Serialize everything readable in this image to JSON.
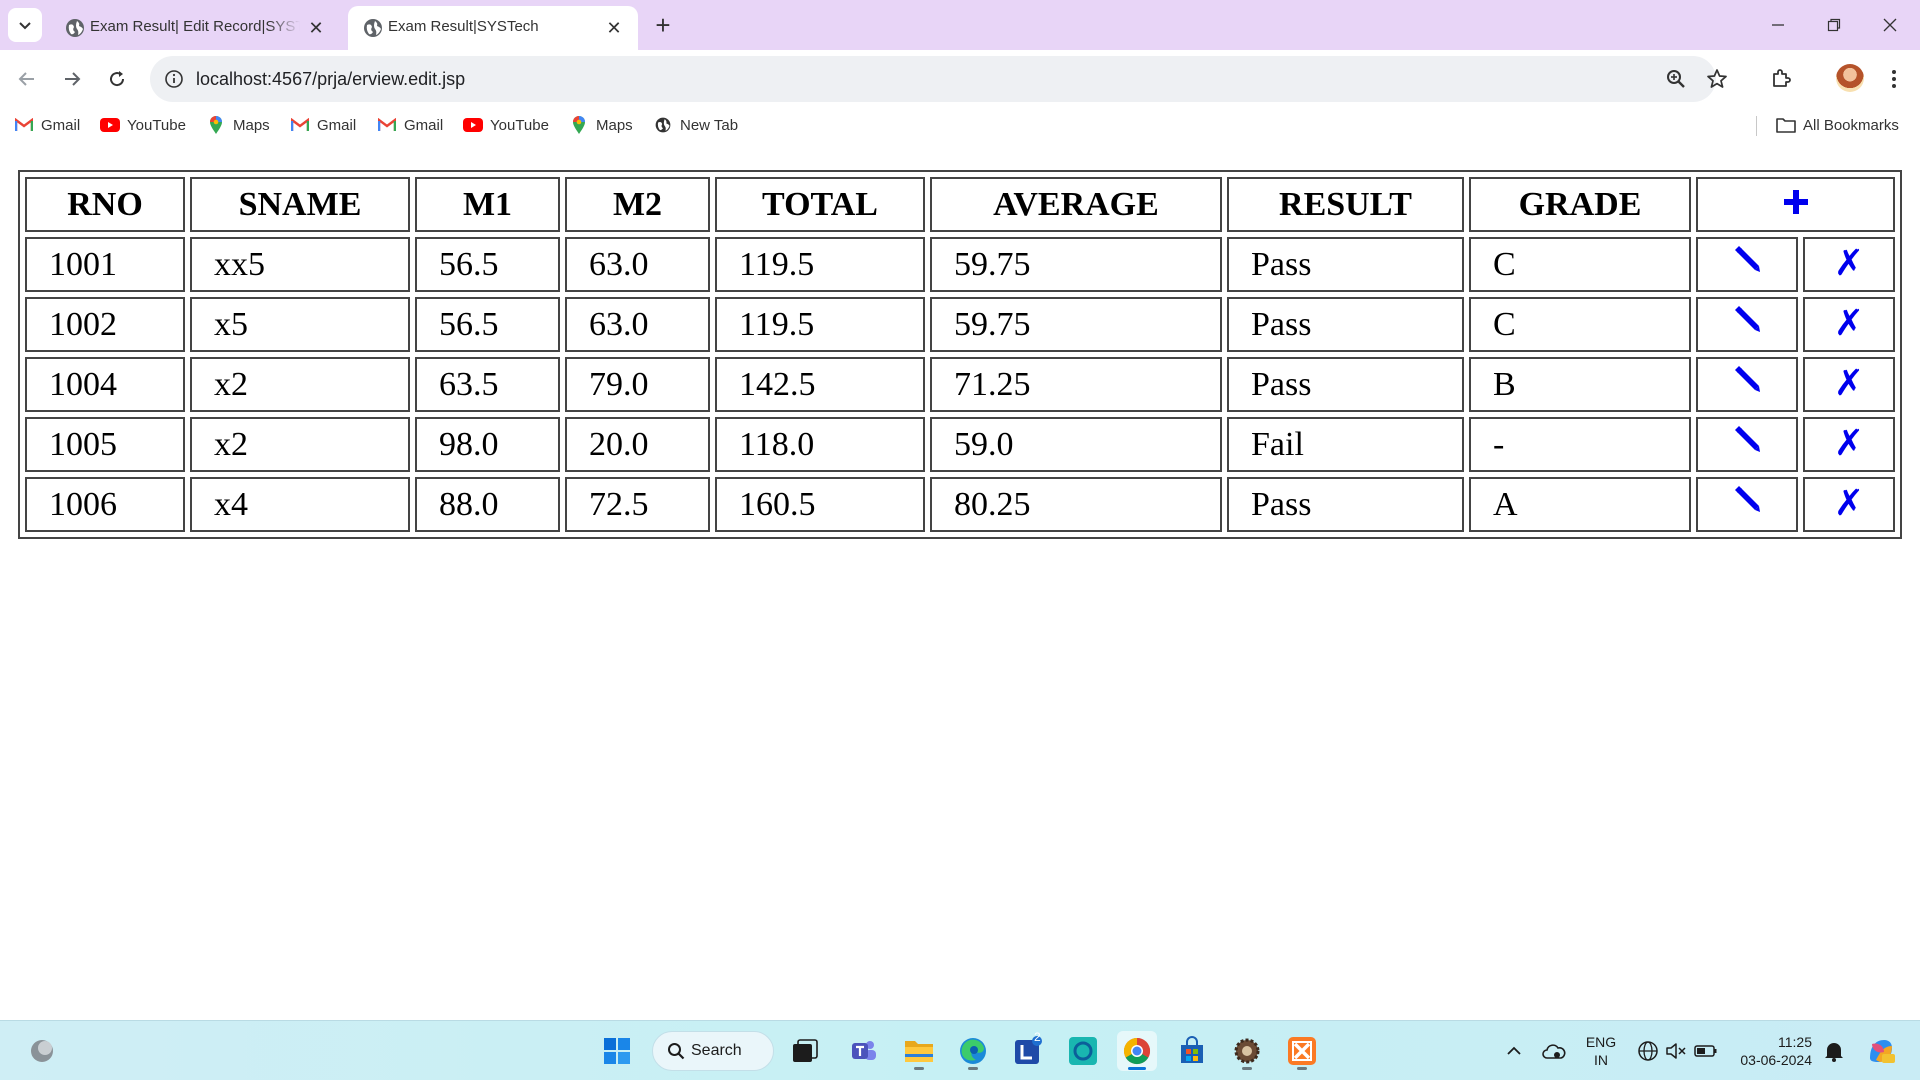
{
  "browser": {
    "tabs": [
      {
        "title": "Exam Result| Edit Record|SYSTech",
        "active": false
      },
      {
        "title": "Exam Result|SYSTech",
        "active": true
      }
    ],
    "url": "localhost:4567/prja/erview.edit.jsp"
  },
  "bookmarks": {
    "items": [
      {
        "label": "Gmail",
        "icon": "gmail-icon"
      },
      {
        "label": "YouTube",
        "icon": "youtube-icon"
      },
      {
        "label": "Maps",
        "icon": "maps-icon"
      },
      {
        "label": "Gmail",
        "icon": "gmail-icon"
      },
      {
        "label": "Gmail",
        "icon": "gmail-icon"
      },
      {
        "label": "YouTube",
        "icon": "youtube-icon"
      },
      {
        "label": "Maps",
        "icon": "maps-icon"
      },
      {
        "label": "New Tab",
        "icon": "globe-icon"
      }
    ],
    "all_bookmarks": "All Bookmarks"
  },
  "table": {
    "headers": [
      "RNO",
      "SNAME",
      "M1",
      "M2",
      "TOTAL",
      "AVERAGE",
      "RESULT",
      "GRADE"
    ],
    "add_icon": "plus-icon",
    "edit_icon": "pencil-icon",
    "delete_icon": "cross-icon",
    "delete_glyph": "✗",
    "rows": [
      {
        "rno": "1001",
        "sname": "xx5",
        "m1": "56.5",
        "m2": "63.0",
        "total": "119.5",
        "average": "59.75",
        "result": "Pass",
        "grade": "C"
      },
      {
        "rno": "1002",
        "sname": "x5",
        "m1": "56.5",
        "m2": "63.0",
        "total": "119.5",
        "average": "59.75",
        "result": "Pass",
        "grade": "C"
      },
      {
        "rno": "1004",
        "sname": "x2",
        "m1": "63.5",
        "m2": "79.0",
        "total": "142.5",
        "average": "71.25",
        "result": "Pass",
        "grade": "B"
      },
      {
        "rno": "1005",
        "sname": "x2",
        "m1": "98.0",
        "m2": "20.0",
        "total": "118.0",
        "average": "59.0",
        "result": "Fail",
        "grade": "-"
      },
      {
        "rno": "1006",
        "sname": "x4",
        "m1": "88.0",
        "m2": "72.5",
        "total": "160.5",
        "average": "80.25",
        "result": "Pass",
        "grade": "A"
      }
    ],
    "action_color": "#0000ee"
  },
  "taskbar": {
    "search_label": "Search",
    "apps": [
      "windows-start-icon",
      "task-view-icon",
      "teams-icon",
      "file-explorer-icon",
      "edge-icon",
      "l-app-icon",
      "green-app-icon",
      "chrome-icon",
      "store-icon",
      "settings-gear-icon",
      "xampp-icon"
    ],
    "l_app_badge": "2",
    "language": {
      "line1": "ENG",
      "line2": "IN"
    },
    "clock": {
      "time": "11:25",
      "date": "03-06-2024"
    }
  }
}
